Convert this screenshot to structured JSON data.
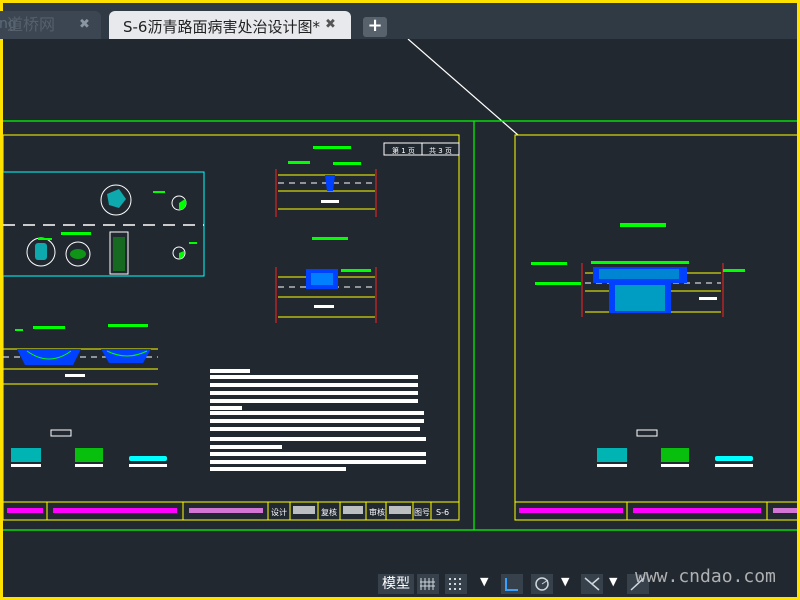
{
  "tabs": [
    {
      "label": "ng",
      "close": "✖"
    },
    {
      "label": "S-6沥青路面病害处治设计图*",
      "close": "✖"
    }
  ],
  "new_tab_label": "+",
  "watermark_top": "道桥网",
  "statusbar": {
    "model_label": "模型",
    "down_arrow": "▼"
  },
  "watermark_bottom": "www.cndao.com",
  "drawing": {
    "sheet_page": "第 1 页",
    "sheet_total": "共 3 页",
    "title_design": "设计",
    "title_review": "复核",
    "title_check": "审核",
    "title_no": "图号",
    "drawing_no": "S-6"
  },
  "colors": {
    "green": "#00ff00",
    "yellow": "#ffff00",
    "blue": "#0000ff",
    "cyan": "#00ffff",
    "magenta": "#ff00ff",
    "white": "#ffffff"
  }
}
